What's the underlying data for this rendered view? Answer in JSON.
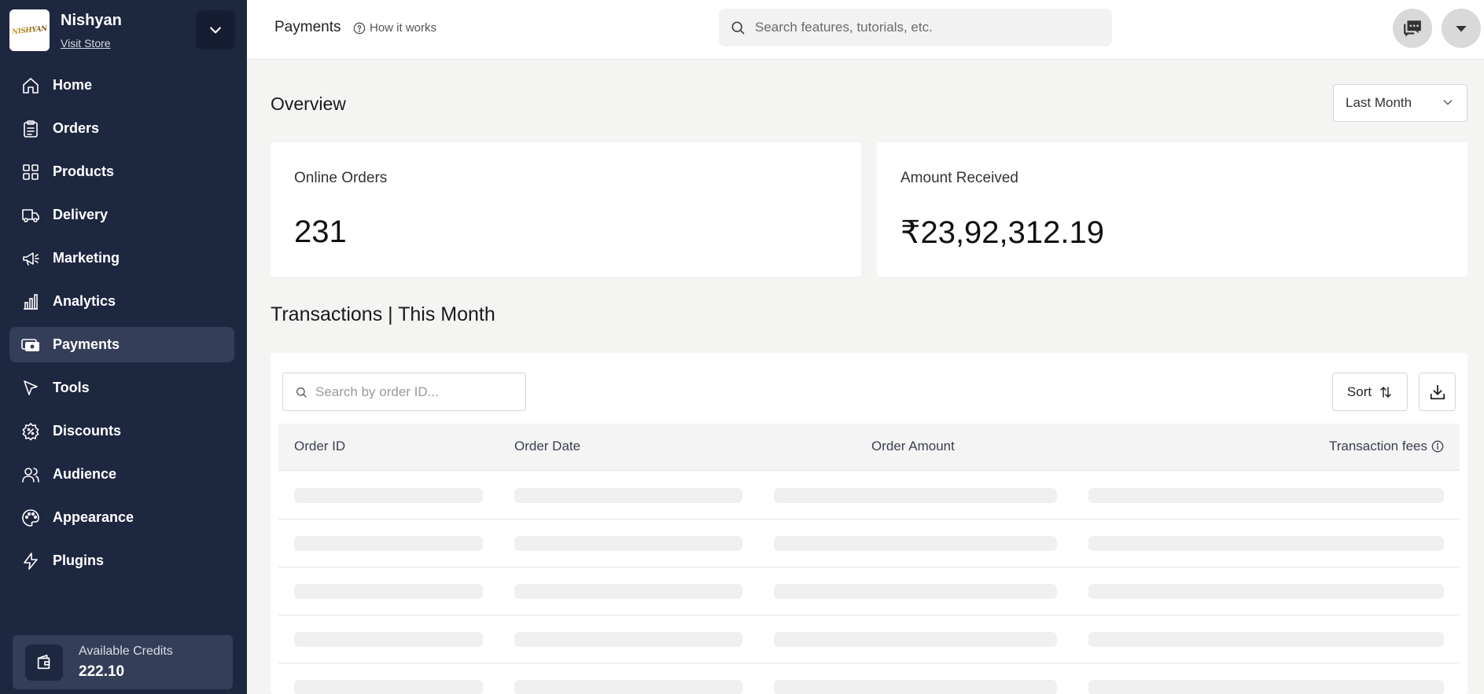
{
  "store": {
    "name": "Nishyan",
    "visit_label": "Visit Store",
    "logo_text": "NISHYAN"
  },
  "nav": [
    {
      "id": "home",
      "label": "Home",
      "icon": "home-icon",
      "active": false
    },
    {
      "id": "orders",
      "label": "Orders",
      "icon": "clipboard-icon",
      "active": false
    },
    {
      "id": "products",
      "label": "Products",
      "icon": "grid-icon",
      "active": false
    },
    {
      "id": "delivery",
      "label": "Delivery",
      "icon": "truck-icon",
      "active": false
    },
    {
      "id": "marketing",
      "label": "Marketing",
      "icon": "megaphone-icon",
      "active": false
    },
    {
      "id": "analytics",
      "label": "Analytics",
      "icon": "bar-chart-icon",
      "active": false
    },
    {
      "id": "payments",
      "label": "Payments",
      "icon": "wallet-cash-icon",
      "active": true
    },
    {
      "id": "tools",
      "label": "Tools",
      "icon": "cursor-icon",
      "active": false
    },
    {
      "id": "discounts",
      "label": "Discounts",
      "icon": "discount-badge-icon",
      "active": false
    },
    {
      "id": "audience",
      "label": "Audience",
      "icon": "users-icon",
      "active": false
    },
    {
      "id": "appearance",
      "label": "Appearance",
      "icon": "palette-icon",
      "active": false
    },
    {
      "id": "plugins",
      "label": "Plugins",
      "icon": "lightning-icon",
      "active": false
    }
  ],
  "credits": {
    "label": "Available Credits",
    "value": "222.10"
  },
  "header": {
    "title": "Payments",
    "how_it_works": "How it works",
    "search_placeholder": "Search features, tutorials, etc."
  },
  "overview": {
    "title": "Overview",
    "period": "Last Month",
    "stats": [
      {
        "label": "Online Orders",
        "value": "231"
      },
      {
        "label": "Amount Received",
        "value": "₹23,92,312.19"
      }
    ]
  },
  "transactions": {
    "title": "Transactions | This Month",
    "search_placeholder": "Search by order ID...",
    "sort_label": "Sort",
    "columns": [
      "Order ID",
      "Order Date",
      "Order Amount",
      "Transaction fees"
    ],
    "loading_rows": 5
  },
  "colors": {
    "sidebar": "#1e2740",
    "active_nav": "#353e58",
    "background": "#f4f4f3"
  }
}
